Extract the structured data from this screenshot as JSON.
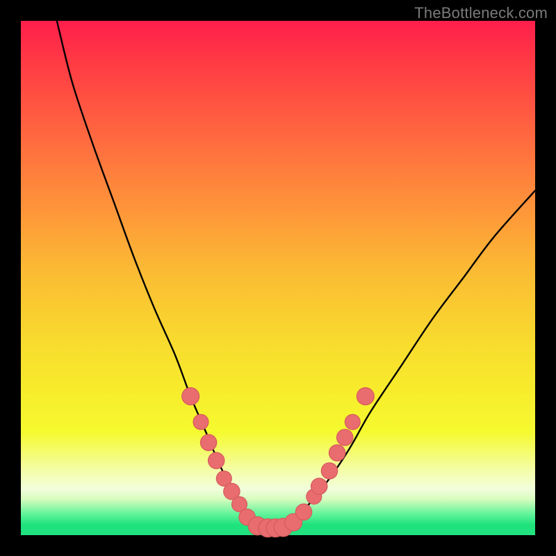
{
  "watermark": "TheBottleneck.com",
  "gradient_colors": {
    "top": "#FF1E4C",
    "mid_upper": "#FE933A",
    "mid": "#F8DA2E",
    "mid_lower": "#F5FA2F",
    "low_band": "#F4FDA2",
    "green_light": "#5EF398",
    "green": "#22E280"
  },
  "curve_color": "#000000",
  "marker_color": "#E96C6E",
  "chart_data": {
    "type": "line",
    "title": "",
    "xlabel": "",
    "ylabel": "",
    "xlim": [
      0,
      100
    ],
    "ylim": [
      0,
      100
    ],
    "grid": false,
    "legend": false,
    "series": [
      {
        "name": "bottleneck-curve",
        "x": [
          7,
          10,
          14,
          18,
          22,
          26,
          30,
          33,
          36,
          38.5,
          41,
          43,
          45,
          47,
          49,
          51,
          53,
          56,
          60,
          64,
          68,
          74,
          80,
          86,
          92,
          100
        ],
        "y": [
          100,
          88,
          76,
          65,
          54,
          44,
          35,
          27,
          20,
          14,
          9,
          5.5,
          3,
          1.8,
          1.5,
          1.8,
          3,
          6,
          11,
          17,
          24,
          33,
          42,
          50,
          58,
          67
        ]
      }
    ],
    "markers": [
      {
        "x": 33,
        "y": 27,
        "r": 1.6
      },
      {
        "x": 35,
        "y": 22,
        "r": 1.4
      },
      {
        "x": 36.5,
        "y": 18,
        "r": 1.5
      },
      {
        "x": 38,
        "y": 14.5,
        "r": 1.5
      },
      {
        "x": 39.5,
        "y": 11,
        "r": 1.4
      },
      {
        "x": 41,
        "y": 8.5,
        "r": 1.5
      },
      {
        "x": 42.5,
        "y": 6,
        "r": 1.4
      },
      {
        "x": 44,
        "y": 3.5,
        "r": 1.5
      },
      {
        "x": 46,
        "y": 1.8,
        "r": 1.7
      },
      {
        "x": 48,
        "y": 1.4,
        "r": 1.7
      },
      {
        "x": 49.5,
        "y": 1.4,
        "r": 1.7
      },
      {
        "x": 51,
        "y": 1.5,
        "r": 1.7
      },
      {
        "x": 53,
        "y": 2.5,
        "r": 1.6
      },
      {
        "x": 55,
        "y": 4.5,
        "r": 1.5
      },
      {
        "x": 57,
        "y": 7.5,
        "r": 1.4
      },
      {
        "x": 58,
        "y": 9.5,
        "r": 1.5
      },
      {
        "x": 60,
        "y": 12.5,
        "r": 1.5
      },
      {
        "x": 61.5,
        "y": 16,
        "r": 1.5
      },
      {
        "x": 63,
        "y": 19,
        "r": 1.5
      },
      {
        "x": 64.5,
        "y": 22,
        "r": 1.4
      },
      {
        "x": 67,
        "y": 27,
        "r": 1.6
      }
    ]
  }
}
